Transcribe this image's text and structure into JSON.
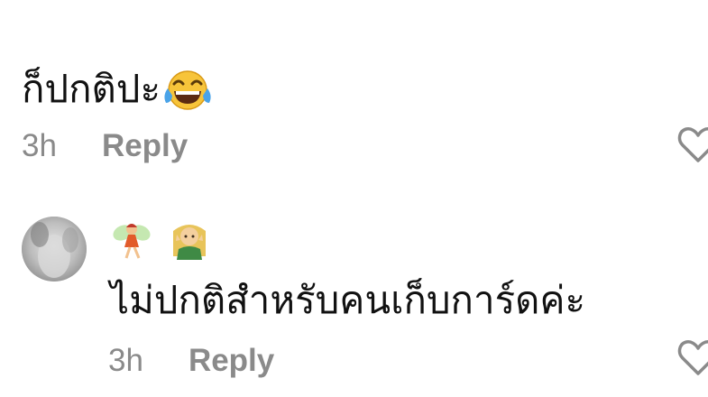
{
  "comment1": {
    "text": "ก็ปกติปะ",
    "emoji": "face-with-tears-of-joy",
    "time": "3h",
    "reply_label": "Reply"
  },
  "comment2": {
    "username_emojis": [
      "fairy",
      "elf"
    ],
    "text": "ไม่ปกติสำหรับคนเก็บการ์ดค่ะ",
    "time": "3h",
    "reply_label": "Reply"
  },
  "colors": {
    "text": "#111111",
    "meta": "#8a8a8a",
    "heart_stroke": "#8a8a8a"
  }
}
